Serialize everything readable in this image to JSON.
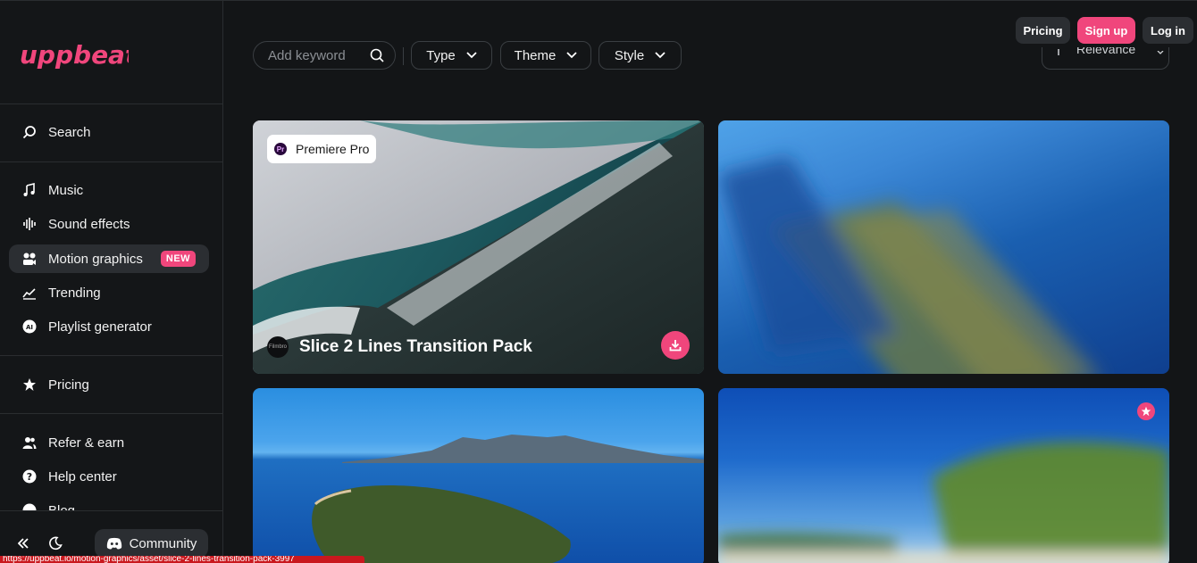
{
  "brand": {
    "logo_text": "uppbeat",
    "accent": "#f0467c"
  },
  "sidebar": {
    "search_label": "Search",
    "items": [
      {
        "label": "Music",
        "icon": "music-note-icon"
      },
      {
        "label": "Sound effects",
        "icon": "waveform-icon"
      },
      {
        "label": "Motion graphics",
        "icon": "motion-graphics-icon",
        "badge": "NEW",
        "active": true
      },
      {
        "label": "Trending",
        "icon": "trending-icon"
      },
      {
        "label": "Playlist generator",
        "icon": "ai-icon"
      }
    ],
    "pricing_label": "Pricing",
    "extra": [
      {
        "label": "Refer & earn",
        "icon": "users-icon"
      },
      {
        "label": "Help center",
        "icon": "help-icon"
      },
      {
        "label": "Blog",
        "icon": "blog-icon"
      }
    ],
    "community_label": "Community"
  },
  "header": {
    "search_placeholder": "Add keyword",
    "filters": [
      "Type",
      "Theme",
      "Style"
    ],
    "sort_label": "Relevance",
    "pricing_btn": "Pricing",
    "signup_btn": "Sign up",
    "login_btn": "Log in"
  },
  "cards": [
    {
      "app_tag": "Premiere Pro",
      "app_tag_icon": "Pr",
      "title": "Slice 2 Lines Transition Pack",
      "creator": "Filmbro"
    },
    {
      "title": ""
    },
    {
      "title": ""
    },
    {
      "title": "",
      "premium": true
    }
  ],
  "status_url": "https://uppbeat.io/motion-graphics/asset/slice-2-lines-transition-pack-3997"
}
